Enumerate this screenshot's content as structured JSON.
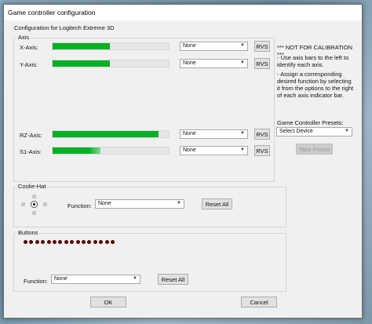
{
  "window": {
    "title": "Game controller configuration"
  },
  "config_label": "Configuration for Logitech Extreme 3D",
  "axis": {
    "label": "Axis",
    "rows": [
      {
        "name": "X-Axis:",
        "fill": 0.49,
        "function": "None",
        "rvs": "RVS"
      },
      {
        "name": "Y-Axis:",
        "fill": 0.49,
        "function": "None",
        "rvs": "RVS"
      },
      {
        "name": "RZ-Axis:",
        "fill": 0.91,
        "function": "None",
        "rvs": "RVS"
      },
      {
        "name": "S1-Axis:",
        "fill": 0.41,
        "function": "None",
        "rvs": "RVS"
      }
    ]
  },
  "notes": {
    "heading": "*** NOT FOR CALIBRATION ***",
    "line1": "- Use axis bars to the left to identify each axis.",
    "line2": "- Assign a corresponding desired function by selecting it from the options to the right of each axis indicator bar."
  },
  "presets": {
    "label": "Game Controller Presets:",
    "value": "Select Device",
    "take": "Take Preset"
  },
  "coolie": {
    "label": "Coolie-Hat",
    "function_label": "Function:",
    "function": "None",
    "reset": "Reset All"
  },
  "buttons": {
    "label": "Buttons",
    "count": 16,
    "function_label": "Function:",
    "function": "None",
    "reset": "Reset All"
  },
  "footer": {
    "ok": "OK",
    "cancel": "Cancel"
  },
  "colors": {
    "bar_fill": "#06b025",
    "button_dot": "#5a0000"
  }
}
